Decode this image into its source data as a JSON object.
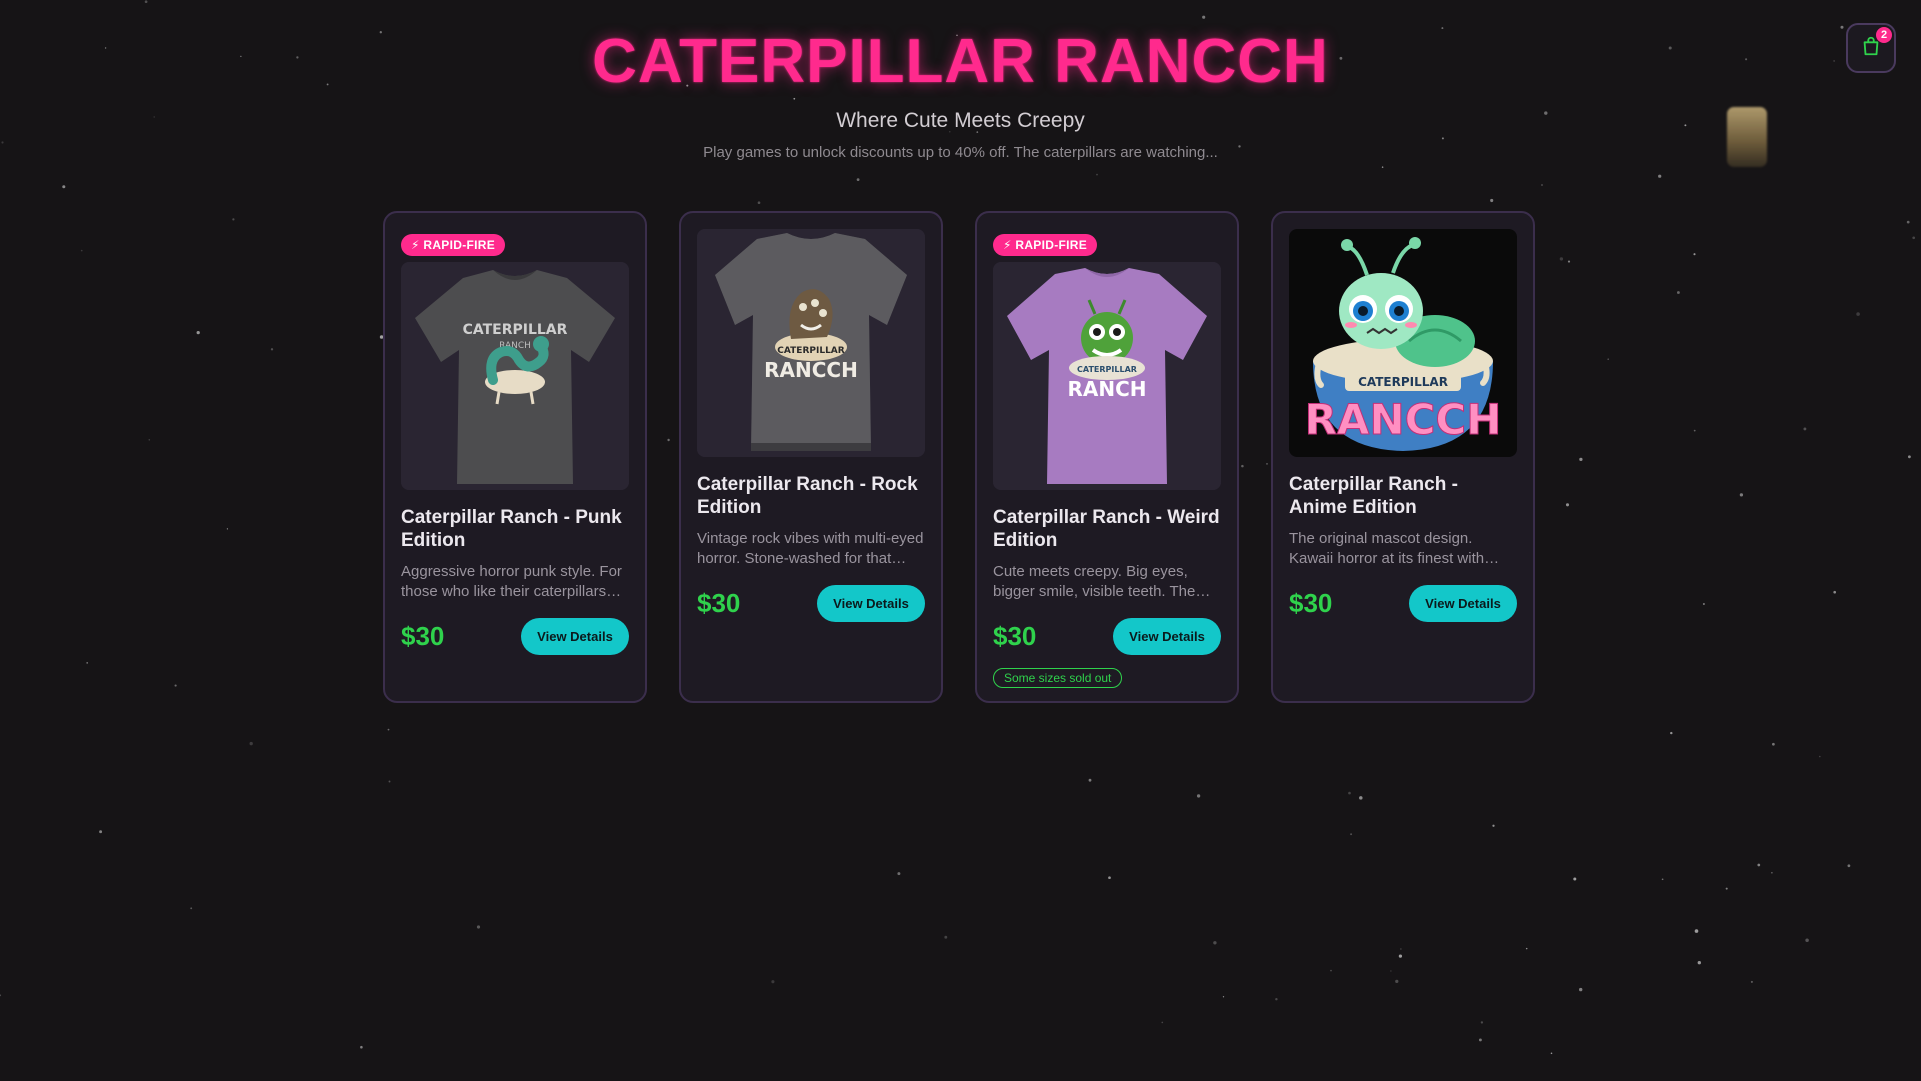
{
  "header": {
    "title": "CATERPILLAR RANCCH",
    "tagline": "Where Cute Meets Creepy",
    "subline": "Play games to unlock discounts up to 40% off. The caterpillars are watching..."
  },
  "cart": {
    "icon": "shopping-bag-icon",
    "count": "2"
  },
  "colors": {
    "accent": "#ff2a8d",
    "price": "#2fd24c",
    "button": "#13c7c9",
    "background": "#161416"
  },
  "products": [
    {
      "badge": "⚡ RAPID-FIRE",
      "name": "Caterpillar Ranch - Punk Edition",
      "description": "Aggressive horror punk style. For those who like their caterpillars with attitude.",
      "price": "$30",
      "button": "View Details",
      "stock_note": "",
      "image": "grey-tshirt-punk"
    },
    {
      "badge": "",
      "name": "Caterpillar Ranch - Rock Edition",
      "description": "Vintage rock vibes with multi-eyed horror. Stone-washed for that lived-in look.",
      "price": "$30",
      "button": "View Details",
      "stock_note": "",
      "image": "stonewash-tshirt-rock"
    },
    {
      "badge": "⚡ RAPID-FIRE",
      "name": "Caterpillar Ranch - Weird Edition",
      "description": "Cute meets creepy. Big eyes, bigger smile, visible teeth. The weird one.",
      "price": "$30",
      "button": "View Details",
      "stock_note": "Some sizes sold out",
      "image": "purple-tshirt-weird"
    },
    {
      "badge": "",
      "name": "Caterpillar Ranch - Anime Edition",
      "description": "The original mascot design. Kawaii horror at its finest with dripping letters.",
      "price": "$30",
      "button": "View Details",
      "stock_note": "",
      "image": "anime-mascot-artwork"
    }
  ]
}
